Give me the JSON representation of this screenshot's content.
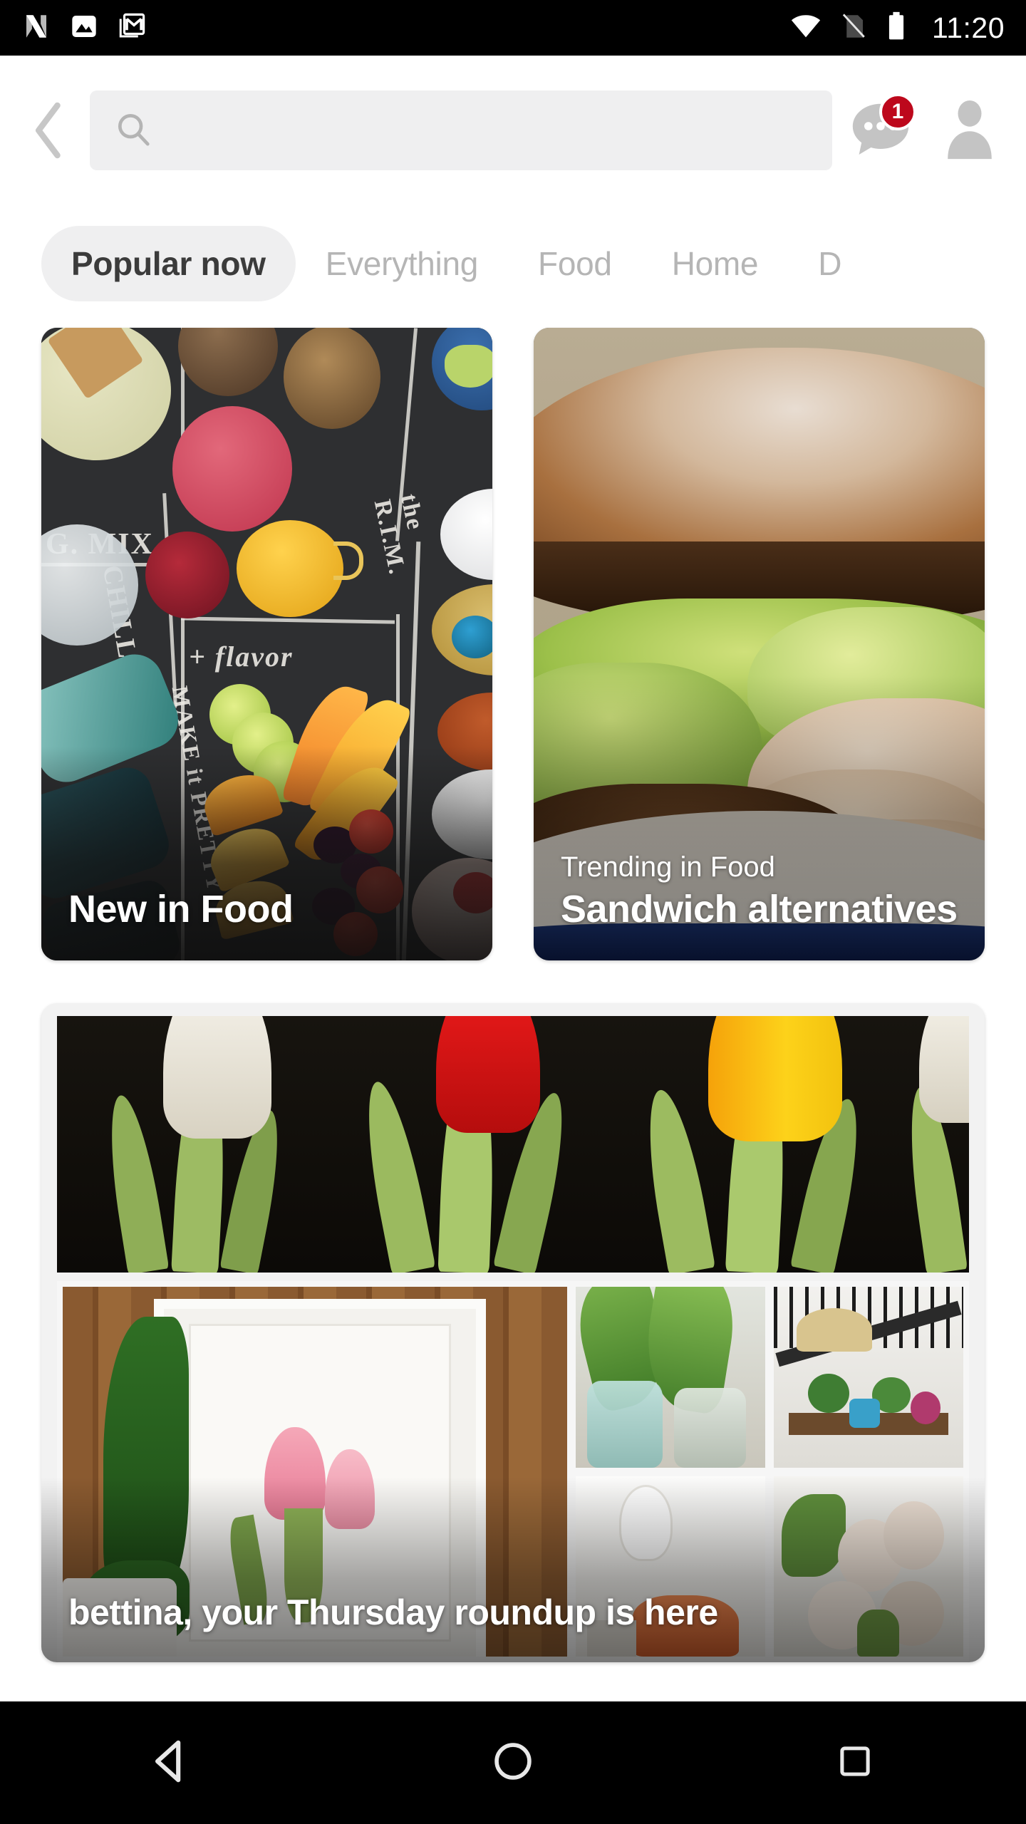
{
  "status_bar": {
    "time": "11:20",
    "left_icons": [
      "android-n-icon",
      "screenshot-image-icon",
      "gmail-icon"
    ],
    "right_icons": [
      "wifi-icon",
      "no-sim-icon",
      "battery-full-icon"
    ],
    "background": "#000000"
  },
  "app_bar": {
    "back_label": "‹",
    "search": {
      "value": "",
      "placeholder": ""
    },
    "messages": {
      "badge_count": "1",
      "badge_color": "#bd081c"
    },
    "profile_label": ""
  },
  "tabs": {
    "items": [
      {
        "label": "Popular now",
        "active": true
      },
      {
        "label": "Everything",
        "active": false
      },
      {
        "label": "Food",
        "active": false
      },
      {
        "label": "Home",
        "active": false
      },
      {
        "label": "D",
        "active": false
      }
    ]
  },
  "feed": {
    "cards": [
      {
        "id": "new-in-food",
        "eyebrow": "",
        "title": "New in Food",
        "image_description": "chalkboard cocktail flat-lay with fruit, juices and spices",
        "chalk_labels": [
          "G. MIX",
          "CHILL",
          "+ flavor",
          "MAKE it PRETTY",
          "the R.I.M."
        ]
      },
      {
        "id": "sandwich-alternatives",
        "eyebrow": "Trending in Food",
        "title": "Sandwich alternatives",
        "image_description": "portobello mushroom bun sandwich with lettuce and turkey"
      },
      {
        "id": "thursday-roundup",
        "eyebrow": "",
        "title": "bettina, your Thursday roundup is here",
        "image_description": "tulips banner above a collage of framed tulip art, vases and home decor"
      }
    ]
  },
  "nav_bar": {
    "items": [
      {
        "name": "back",
        "icon": "triangle-back-icon"
      },
      {
        "name": "home",
        "icon": "circle-home-icon"
      },
      {
        "name": "recents",
        "icon": "square-recents-icon"
      }
    ],
    "background": "#000000"
  }
}
